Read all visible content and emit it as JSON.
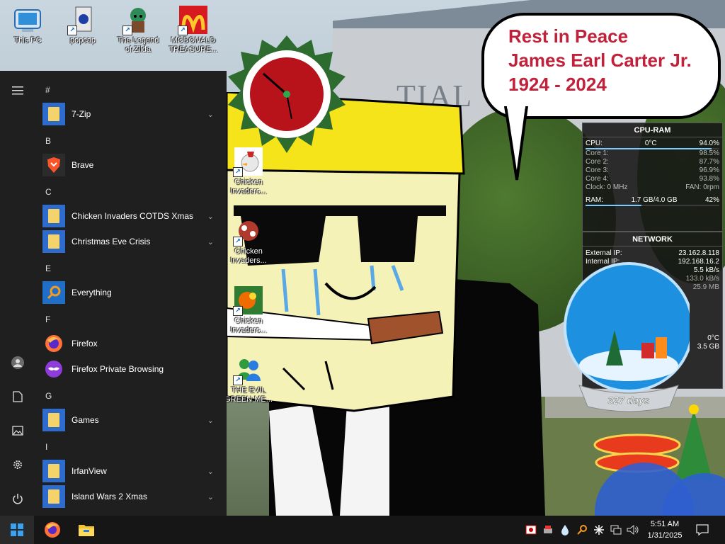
{
  "desktop_icons": [
    {
      "label": "This PC",
      "icon": "this-pc-icon"
    },
    {
      "label": "popcap",
      "icon": "popcap-icon"
    },
    {
      "label": "The Legend of Zilda",
      "icon": "zilda-icon"
    },
    {
      "label": "MCDONALD TREASURE...",
      "icon": "mcdonalds-icon"
    },
    {
      "label": "Chicken Invaders...",
      "icon": "chicken-invaders-icon"
    },
    {
      "label": "Chicken Invaders...",
      "icon": "chicken-invaders-icon"
    },
    {
      "label": "Chicken Invaders...",
      "icon": "chicken-invaders-icon"
    },
    {
      "label": "THE EVIL GREEN ME...",
      "icon": "messenger-icon"
    }
  ],
  "speech_bubble": {
    "line1": "Rest in Peace",
    "line2": "James Earl Carter Jr.",
    "line3": "1924 - 2024"
  },
  "cpu_ram": {
    "title": "CPU-RAM",
    "cpu_label": "CPU:",
    "cpu_temp": "0°C",
    "cpu_pct": "94.0%",
    "cores": [
      {
        "label": "Core 1:",
        "value": "98.5%",
        "fill": 0.985
      },
      {
        "label": "Core 2:",
        "value": "87.7%",
        "fill": 0.877
      },
      {
        "label": "Core 3:",
        "value": "96.9%",
        "fill": 0.969
      },
      {
        "label": "Core 4:",
        "value": "93.8%",
        "fill": 0.938
      }
    ],
    "clock": "Clock: 0 MHz",
    "fan": "FAN: 0rpm",
    "ram_label": "RAM:",
    "ram_used": "1.7 GB/4.0 GB",
    "ram_pct": "42%"
  },
  "network": {
    "title": "NETWORK",
    "external_ip_label": "External IP:",
    "external_ip": "23.162.8.118",
    "internal_ip_label": "Internal IP:",
    "internal_ip": "192.168.16.2",
    "down": "5.5 kB/s",
    "up": "133.0 kB/s",
    "total": "25.9 MB",
    "temp": "0°C",
    "extra": "3.5 GB"
  },
  "snow_globe": {
    "days": "327 days"
  },
  "start_menu": {
    "sections": [
      {
        "letter": "#",
        "apps": [
          {
            "label": "7-Zip",
            "icon": "folder-icon",
            "expandable": true
          }
        ]
      },
      {
        "letter": "B",
        "apps": [
          {
            "label": "Brave",
            "icon": "brave-icon",
            "expandable": false
          }
        ]
      },
      {
        "letter": "C",
        "apps": [
          {
            "label": "Chicken Invaders COTDS Xmas",
            "icon": "folder-icon",
            "expandable": true
          },
          {
            "label": "Christmas Eve Crisis",
            "icon": "folder-icon",
            "expandable": true
          }
        ]
      },
      {
        "letter": "E",
        "apps": [
          {
            "label": "Everything",
            "icon": "everything-icon",
            "expandable": false
          }
        ]
      },
      {
        "letter": "F",
        "apps": [
          {
            "label": "Firefox",
            "icon": "firefox-icon",
            "expandable": false
          },
          {
            "label": "Firefox Private Browsing",
            "icon": "firefox-private-icon",
            "expandable": false
          }
        ]
      },
      {
        "letter": "G",
        "apps": [
          {
            "label": "Games",
            "icon": "folder-icon",
            "expandable": true
          }
        ]
      },
      {
        "letter": "I",
        "apps": [
          {
            "label": "IrfanView",
            "icon": "folder-icon",
            "expandable": true
          },
          {
            "label": "Island Wars 2 Xmas",
            "icon": "folder-icon",
            "expandable": true
          }
        ]
      }
    ]
  },
  "taskbar": {
    "time": "5:51 AM",
    "date": "1/31/2025"
  }
}
